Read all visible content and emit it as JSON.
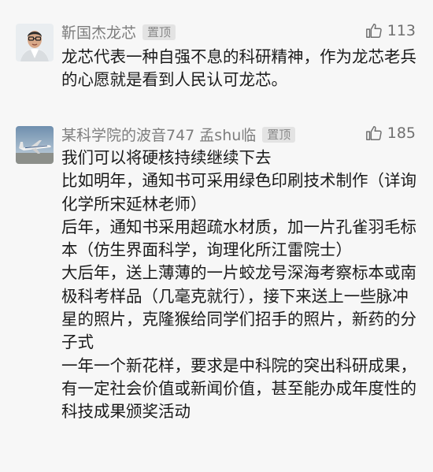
{
  "comments": [
    {
      "author": "靳国杰龙芯",
      "tag": "置顶",
      "likes": "113",
      "avatar_icon": "person-portrait-avatar",
      "text": [
        "龙芯代表一种自强不息的科研精神，作为龙芯老兵的心愿就是看到人民认可龙芯。"
      ]
    },
    {
      "author": "某科学院的波音747 孟shu临",
      "tag": "置顶",
      "likes": "185",
      "avatar_icon": "airplane-avatar",
      "text": [
        "我们可以将硬核持续继续下去",
        "比如明年，通知书可采用绿色印刷技术制作（详询化学所宋延林老师）",
        "后年，通知书采用超疏水材质，加一片孔雀羽毛标本（仿生界面科学，询理化所江雷院士）",
        "大后年，送上薄薄的一片蛟龙号深海考察标本或南极科考样品（几毫克就行），接下来送上一些脉冲星的照片，克隆猴给同学们招手的照片，新药的分子式",
        "一年一个新花样，要求是中科院的突出科研成果，有一定社会价值或新闻价值，甚至能办成年度性的科技成果颁奖活动"
      ]
    }
  ]
}
